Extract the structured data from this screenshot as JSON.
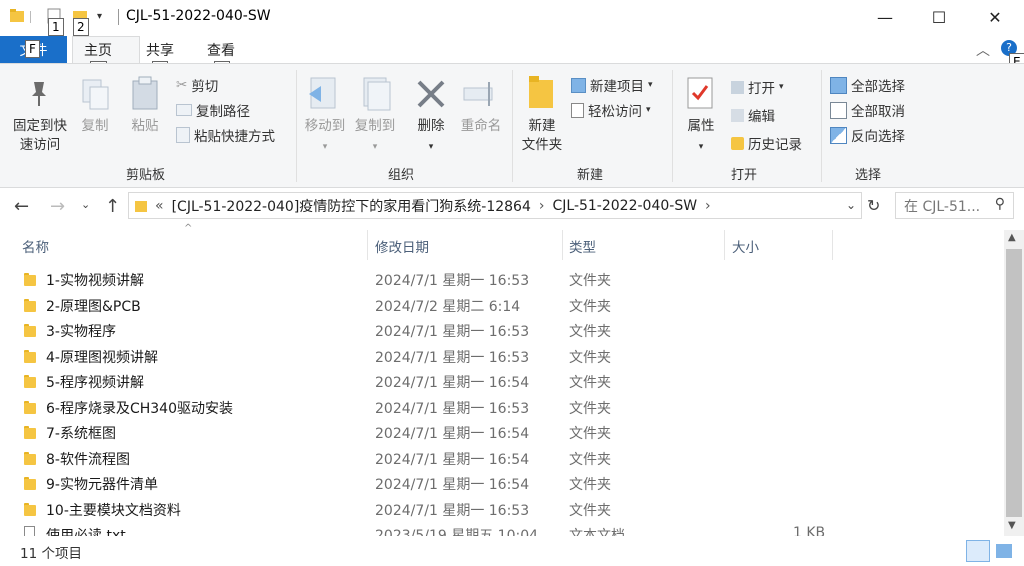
{
  "window": {
    "title": "CJL-51-2022-040-SW",
    "controls": {
      "minimize": "—",
      "maximize": "☐",
      "close": "✕"
    }
  },
  "keytips": {
    "file": "F",
    "qat1": "1",
    "qat2": "2",
    "home": "H",
    "share": "S",
    "view": "V",
    "expand": "E"
  },
  "tabs": {
    "file": "文件",
    "home": "主页",
    "share": "共享",
    "view": "查看"
  },
  "ribbon": {
    "clipboard": {
      "label": "剪贴板",
      "pin": "固定到快\n速访问",
      "copy": "复制",
      "paste": "粘贴",
      "cut": "剪切",
      "copy_path": "复制路径",
      "paste_shortcut": "粘贴快捷方式"
    },
    "organize": {
      "label": "组织",
      "move_to": "移动到",
      "copy_to": "复制到",
      "delete": "删除",
      "rename": "重命名"
    },
    "new": {
      "label": "新建",
      "new_folder": "新建\n文件夹",
      "new_item": "新建项目",
      "easy_access": "轻松访问"
    },
    "open": {
      "label": "打开",
      "properties": "属性",
      "open": "打开",
      "edit": "编辑",
      "history": "历史记录"
    },
    "select": {
      "label": "选择",
      "select_all": "全部选择",
      "select_none": "全部取消",
      "invert": "反向选择"
    }
  },
  "address": {
    "overflow": "«",
    "crumb1": "[CJL-51-2022-040]疫情防控下的家用看门狗系统-12864",
    "crumb2": "CJL-51-2022-040-SW",
    "sep": "›",
    "search_placeholder": "在 CJL-51..."
  },
  "columns": {
    "name": "名称",
    "date": "修改日期",
    "type": "类型",
    "size": "大小"
  },
  "files": [
    {
      "name": "1-实物视频讲解",
      "date": "2024/7/1 星期一 16:53",
      "type": "文件夹",
      "size": "",
      "kind": "folder"
    },
    {
      "name": "2-原理图&PCB",
      "date": "2024/7/2 星期二 6:14",
      "type": "文件夹",
      "size": "",
      "kind": "folder"
    },
    {
      "name": "3-实物程序",
      "date": "2024/7/1 星期一 16:53",
      "type": "文件夹",
      "size": "",
      "kind": "folder"
    },
    {
      "name": "4-原理图视频讲解",
      "date": "2024/7/1 星期一 16:53",
      "type": "文件夹",
      "size": "",
      "kind": "folder"
    },
    {
      "name": "5-程序视频讲解",
      "date": "2024/7/1 星期一 16:54",
      "type": "文件夹",
      "size": "",
      "kind": "folder"
    },
    {
      "name": "6-程序烧录及CH340驱动安装",
      "date": "2024/7/1 星期一 16:53",
      "type": "文件夹",
      "size": "",
      "kind": "folder"
    },
    {
      "name": "7-系统框图",
      "date": "2024/7/1 星期一 16:54",
      "type": "文件夹",
      "size": "",
      "kind": "folder"
    },
    {
      "name": "8-软件流程图",
      "date": "2024/7/1 星期一 16:54",
      "type": "文件夹",
      "size": "",
      "kind": "folder"
    },
    {
      "name": "9-实物元器件清单",
      "date": "2024/7/1 星期一 16:54",
      "type": "文件夹",
      "size": "",
      "kind": "folder"
    },
    {
      "name": "10-主要模块文档资料",
      "date": "2024/7/1 星期一 16:53",
      "type": "文件夹",
      "size": "",
      "kind": "folder"
    },
    {
      "name": "使用必读.txt",
      "date": "2023/5/19 星期五 10:04",
      "type": "文本文档",
      "size": "1 KB",
      "kind": "txt"
    }
  ],
  "status": {
    "count": "11 个项目"
  },
  "colors": {
    "accent": "#1a6fc9",
    "folder": "#f5c542",
    "ribbon_bg": "#f5f6f7"
  }
}
